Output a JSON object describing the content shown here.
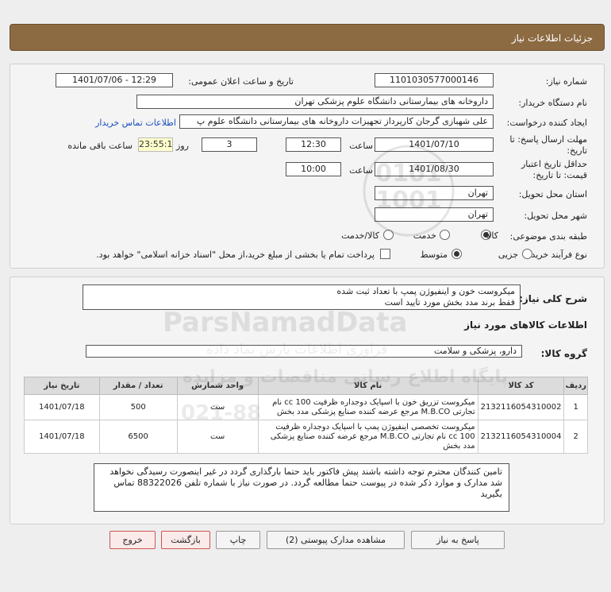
{
  "header": {
    "title": "جزئیات اطلاعات نیاز"
  },
  "form": {
    "need_number_label": "شماره نیاز:",
    "need_number": "1101030577000146",
    "announce_label": "تاریخ و ساعت اعلان عمومی:",
    "announce_value": "1401/07/06 - 12:29",
    "buyer_label": "نام دستگاه خریدار:",
    "buyer_value": "داروخانه های بیمارستانی دانشگاه علوم پزشکی تهران",
    "creator_label": "ایجاد کننده درخواست:",
    "creator_value": "علی شهبازی گرجان کارپرداز تجهیزات داروخانه های بیمارستانی دانشگاه علوم پ",
    "contact_link": "اطلاعات تماس خریدار",
    "deadline_label_1": "مهلت ارسال پاسخ: تا",
    "deadline_label_2": "تاریخ:",
    "deadline_date": "1401/07/10",
    "time_label": "ساعت",
    "deadline_time": "12:30",
    "days_value": "3",
    "days_label": "روز و",
    "remaining_time": "23:55:16",
    "remaining_label": "ساعت باقی مانده",
    "validity_label_1": "حداقل تاریخ اعتبار",
    "validity_label_2": "قیمت: تا تاریخ:",
    "validity_date": "1401/08/30",
    "validity_time": "10:00",
    "province_label": "استان محل تحویل:",
    "province_value": "تهران",
    "city_label": "شهر محل تحویل:",
    "city_value": "تهران",
    "category_label": "طبقه بندی موضوعی:",
    "category_options": [
      "کالا",
      "خدمت",
      "کالا/خدمت"
    ],
    "process_label": "نوع فرآیند خرید :",
    "process_options": [
      "جزیی",
      "متوسط"
    ],
    "payment_text": "پرداخت تمام یا بخشی از مبلغ خرید،از محل \"اسناد خزانه اسلامی\" خواهد بود."
  },
  "summary": {
    "label": "شرح کلی نیاز:",
    "line1": "میکروست خون و اینفیوژن پمپ با تعداد ثبت شده",
    "line2": "فقط برند مدد بخش مورد تایید است"
  },
  "goods": {
    "section_title": "اطلاعات کالاهای مورد نیاز",
    "group_label": "گروه کالا:",
    "group_value": "دارو، پزشکی و سلامت"
  },
  "table": {
    "headers": [
      "ردیف",
      "کد کالا",
      "نام کالا",
      "واحد شمارش",
      "تعداد / مقدار",
      "تاریخ نیاز"
    ],
    "rows": [
      {
        "idx": "1",
        "code": "2132116054310002",
        "name": "میکروست تزریق خون با اسپایک دوجداره ظرفیت 100 cc نام تجارتی M.B.CO مرجع عرضه کننده صنایع پزشکی مدد بخش",
        "unit": "ست",
        "qty": "500",
        "date": "1401/07/18"
      },
      {
        "idx": "2",
        "code": "2132116054310004",
        "name": "میکروست تخصصی اینفیوژن پمپ با اسپایک دوجداره ظرفیت 100 cc نام تجارتی M.B.CO مرجع عرضه کننده صنایع پزشکی مدد بخش",
        "unit": "ست",
        "qty": "6500",
        "date": "1401/07/18"
      }
    ]
  },
  "note": "تامین کنندگان محترم توجه داشته باشند پیش فاکتور باید حتما بارگذاری گردد در غیر اینصورت رسیدگی نخواهد شد مدارک و موارد ذکر شده در پیوست حتما مطالعه گردد. در صورت نیاز با شماره تلفن 88322026 تماس بگیرید",
  "buttons": {
    "reply": "پاسخ به نیاز",
    "attachments": "مشاهده مدارک پیوستی (2)",
    "print": "چاپ",
    "back": "بازگشت",
    "exit": "خروج"
  },
  "watermark": {
    "brand": "ParsNamadData",
    "line1": "پایگاه اطلاع رسانی مناقصات و مزایده",
    "line2": "فراوری اطلاعات پارس نماد داده",
    "phone": "021-88"
  }
}
